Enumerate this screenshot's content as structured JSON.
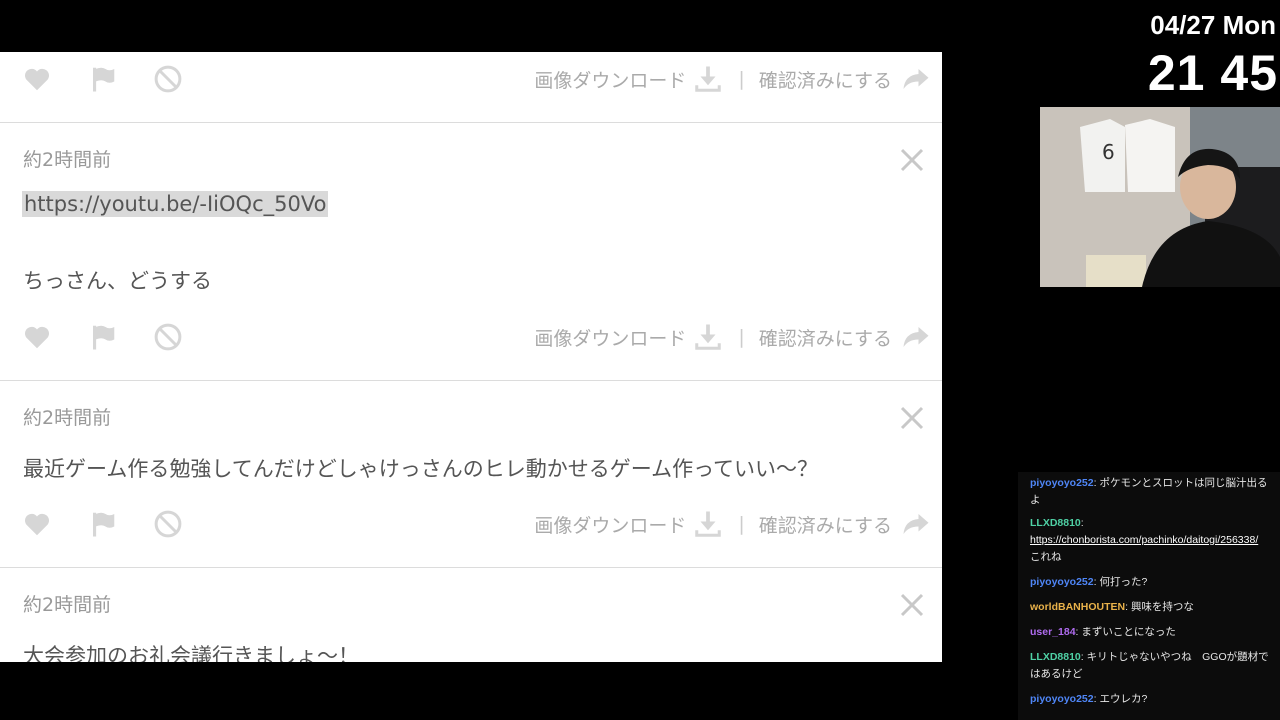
{
  "overlay": {
    "date": "04/27 Mon",
    "time": "21 45"
  },
  "actions": {
    "download_label": "画像ダウンロード",
    "confirm_label": "確認済みにする",
    "separator": "|"
  },
  "cards": [
    {
      "time": "約2時間前",
      "link": "https://youtu.be/-IiOQc_50Vo",
      "text": "ちっさん、どうする"
    },
    {
      "time": "約2時間前",
      "text": "最近ゲーム作る勉強してんだけどしゃけっさんのヒレ動かせるゲーム作っていい〜？"
    },
    {
      "time": "約2時間前",
      "text": "大会参加のお礼会議行きましょ〜！"
    }
  ],
  "chat": {
    "messages": [
      {
        "user": "piyoyoyo252",
        "color": "#4f86f7",
        "text": "ポケモンとスロットは同じ脳汁出るよ"
      },
      {
        "user": "LLXD8810",
        "color": "#4fd1a5",
        "link": "https://chonborista.com/pachinko/daitogi/256338/",
        "text": "これね"
      },
      {
        "user": "piyoyoyo252",
        "color": "#4f86f7",
        "text": "何打った?"
      },
      {
        "user": "worldBANHOUTEN",
        "color": "#e9b24a",
        "text": "興味を持つな"
      },
      {
        "user": "user_184",
        "color": "#b06cf0",
        "text": "まずいことになった"
      },
      {
        "user": "LLXD8810",
        "color": "#4fd1a5",
        "text": "キリトじゃないやつね　GGOが題材ではあるけど"
      },
      {
        "user": "piyoyoyo252",
        "color": "#4f86f7",
        "text": "エウレカ?"
      }
    ]
  }
}
